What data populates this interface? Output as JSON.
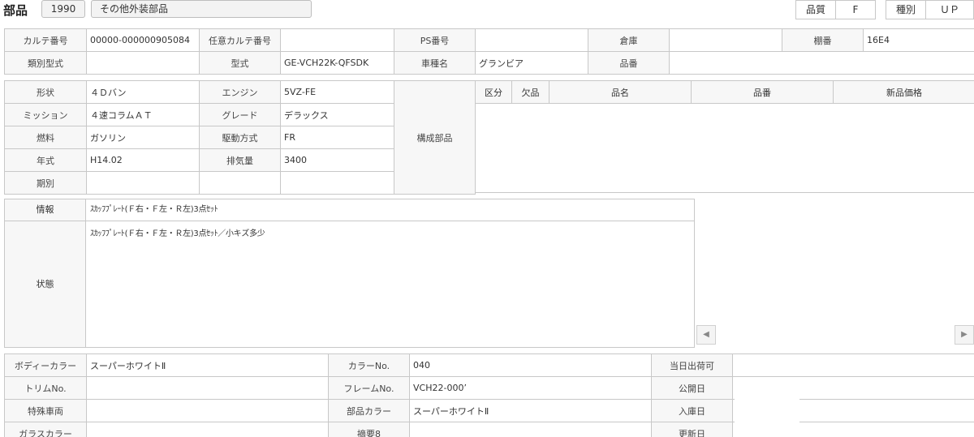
{
  "header": {
    "title": "部品",
    "code": "1990",
    "category": "その他外装部品",
    "quality_label": "品質",
    "quality_value": "F",
    "type_label": "種別",
    "type_value": "ＵＰ"
  },
  "top": {
    "karte_no_label": "カルテ番号",
    "karte_no_value": "00000-000000905084",
    "opt_karte_label": "任意カルテ番号",
    "opt_karte_value": "",
    "ps_no_label": "PS番号",
    "ps_no_value": "",
    "warehouse_label": "倉庫",
    "warehouse_value": "",
    "shelf_label": "棚番",
    "shelf_value": "16E4",
    "class_model_label": "類別型式",
    "class_model_value": "",
    "model_label": "型式",
    "model_value": "GE-VCH22K-QFSDK",
    "car_name_label": "車種名",
    "car_name_value": "グランビア",
    "part_no_label": "品番",
    "part_no_value": ""
  },
  "spec": {
    "shape_label": "形状",
    "shape_value": "４Ｄバン",
    "engine_label": "エンジン",
    "engine_value": "5VZ-FE",
    "mission_label": "ミッション",
    "mission_value": "４速コラムＡＴ",
    "grade_label": "グレード",
    "grade_value": "デラックス",
    "fuel_label": "燃料",
    "fuel_value": "ガソリン",
    "drive_label": "駆動方式",
    "drive_value": "FR",
    "year_label": "年式",
    "year_value": "H14.02",
    "displacement_label": "排気量",
    "displacement_value": "3400",
    "period_label": "期別",
    "period_value": "",
    "components_label": "構成部品"
  },
  "parts_table": {
    "headers": [
      "区分",
      "欠品",
      "品名",
      "品番",
      "新品価格"
    ]
  },
  "info": {
    "info_label": "情報",
    "info_value": "ｽｶｯﾌﾌﾟﾚｰﾄ(Ｆ右・Ｆ左・Ｒ左)3点ｾｯﾄ",
    "condition_label": "状態",
    "condition_value": "ｽｶｯﾌﾌﾟﾚｰﾄ(Ｆ右・Ｆ左・Ｒ左)3点ｾｯﾄ／小キズ多少"
  },
  "bottom": {
    "body_color_label": "ボディーカラー",
    "body_color_value": "スーパーホワイトⅡ",
    "color_no_label": "カラーNo.",
    "color_no_value": "040",
    "same_day_label": "当日出荷可",
    "same_day_value": "",
    "trim_label": "トリムNo.",
    "trim_value": "",
    "frame_label": "フレームNo.",
    "frame_value": "VCH22-000’",
    "published_label": "公開日",
    "published_value": "",
    "special_label": "特殊車両",
    "special_value": "",
    "part_color_label": "部品カラー",
    "part_color_value": "スーパーホワイトⅡ",
    "stock_date_label": "入庫日",
    "stock_date_value": "",
    "glass_label": "ガラスカラー",
    "glass_value": "",
    "memo_label": "摘要8",
    "memo_value": "",
    "updated_label": "更新日",
    "updated_value": ""
  },
  "icons": {
    "scroll_left": "chevron-left-icon",
    "scroll_right": "chevron-right-icon"
  }
}
